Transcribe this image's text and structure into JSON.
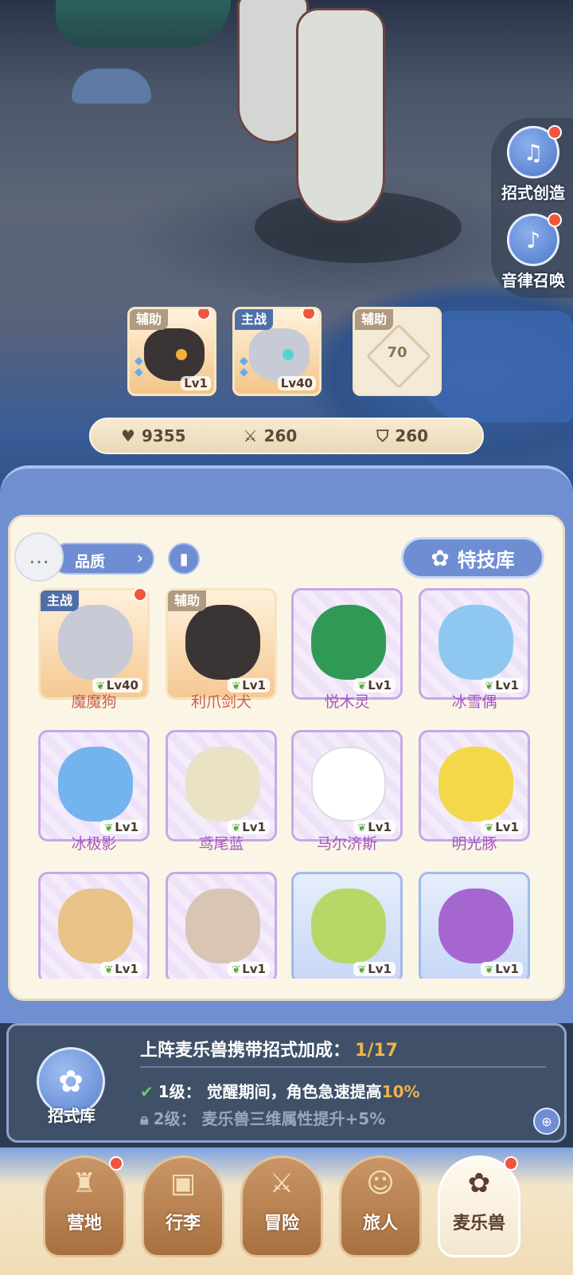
{
  "side_buttons": [
    {
      "label": "招式创造",
      "icon": "book-icon"
    },
    {
      "label": "音律召唤",
      "icon": "lyre-icon"
    }
  ],
  "team": {
    "slots": [
      {
        "tag": "辅助",
        "level": "Lv1",
        "pet": "利爪剑犬"
      },
      {
        "tag": "主战",
        "level": "Lv40",
        "pet": "魔魔狗"
      },
      {
        "tag": "辅助",
        "empty_value": "70"
      }
    ]
  },
  "stats": {
    "hp": "9355",
    "attack": "260",
    "defense": "260"
  },
  "toolbar": {
    "filter_label": "品质",
    "skill_library_label": "特技库"
  },
  "pets": [
    {
      "name": "魔魔狗",
      "level": "Lv40",
      "tag": "主战",
      "frame": "orange",
      "color": "#c8cad6"
    },
    {
      "name": "利爪剑犬",
      "level": "Lv1",
      "tag": "辅助",
      "frame": "orange",
      "color": "#3a3534"
    },
    {
      "name": "悦木灵",
      "level": "Lv1",
      "tag": "",
      "frame": "purple",
      "color": "#2f9a55"
    },
    {
      "name": "冰雪偶",
      "level": "Lv1",
      "tag": "",
      "frame": "purple",
      "color": "#8ec7ef"
    },
    {
      "name": "冰极影",
      "level": "Lv1",
      "tag": "",
      "frame": "purple",
      "color": "#74b4ee"
    },
    {
      "name": "鸢尾蓝",
      "level": "Lv1",
      "tag": "",
      "frame": "purple",
      "color": "#e9e2c4"
    },
    {
      "name": "马尔济斯",
      "level": "Lv1",
      "tag": "",
      "frame": "purple",
      "color": "#ffffff"
    },
    {
      "name": "明光豚",
      "level": "Lv1",
      "tag": "",
      "frame": "purple",
      "color": "#f3d84a"
    },
    {
      "name": "",
      "level": "Lv1",
      "tag": "",
      "frame": "purple",
      "color": "#e7c387"
    },
    {
      "name": "",
      "level": "Lv1",
      "tag": "",
      "frame": "purple",
      "color": "#d9c5b4"
    },
    {
      "name": "",
      "level": "Lv1",
      "tag": "",
      "frame": "blue",
      "color": "#b7d867"
    },
    {
      "name": "",
      "level": "Lv1",
      "tag": "",
      "frame": "blue",
      "color": "#a666d0"
    }
  ],
  "bonus": {
    "icon_label": "招式库",
    "title": "上阵麦乐兽携带招式加成：",
    "count": "1/17",
    "level1_prefix": "1级：  觉醒期间，角色急速提高",
    "level1_value": "10%",
    "level2": "2级：  麦乐兽三维属性提升+5%"
  },
  "nav": [
    {
      "label": "营地",
      "icon": "castle-icon",
      "badge": true
    },
    {
      "label": "行李",
      "icon": "backpack-icon",
      "badge": false
    },
    {
      "label": "冒险",
      "icon": "swords-icon",
      "badge": false
    },
    {
      "label": "旅人",
      "icon": "person-icon",
      "badge": false
    },
    {
      "label": "麦乐兽",
      "icon": "pet-icon",
      "badge": true,
      "active": true
    }
  ]
}
